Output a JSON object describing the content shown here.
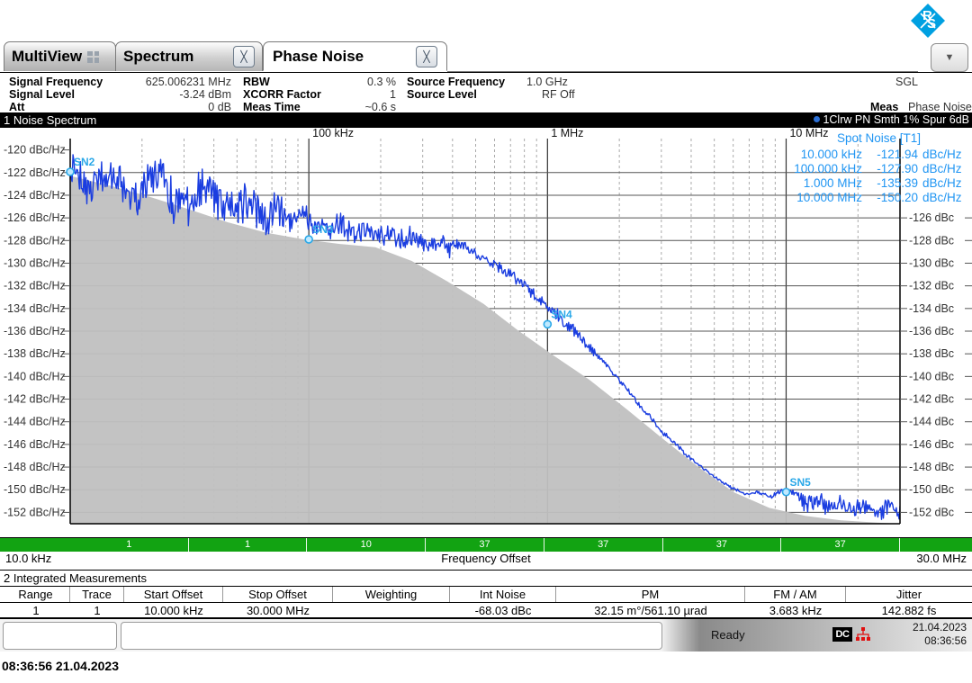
{
  "window": {
    "brand": "R&S",
    "dropdown_icon": "chevron-down-icon"
  },
  "tabs": [
    {
      "id": "multiview",
      "label": "MultiView",
      "icon": "grid-icon",
      "closable": false,
      "active": false
    },
    {
      "id": "spectrum",
      "label": "Spectrum",
      "icon": "close-icon",
      "closable": true,
      "active": false
    },
    {
      "id": "phase-noise",
      "label": "Phase Noise",
      "icon": "close-icon",
      "closable": true,
      "active": true
    }
  ],
  "info_header": {
    "col1": [
      {
        "key": "Signal Frequency",
        "value": "625.006231 MHz"
      },
      {
        "key": "Signal Level",
        "value": "-3.24 dBm"
      },
      {
        "key": "Att",
        "value": "0 dB"
      }
    ],
    "col2": [
      {
        "key": "RBW",
        "value": "0.3 %"
      },
      {
        "key": "XCORR Factor",
        "value": "1"
      },
      {
        "key": "Meas Time",
        "value": "~0.6 s"
      }
    ],
    "col3": [
      {
        "key": "Source Frequency",
        "value": "1.0 GHz"
      },
      {
        "key": "Source Level",
        "value": "RF Off"
      }
    ],
    "sgl": "SGL",
    "meas_key": "Meas",
    "meas_value": "Phase Noise"
  },
  "plot": {
    "title": "1 Noise Spectrum",
    "trace_header": "1Clrw PN Smth 1% Spur 6dB",
    "spot_noise_title": "Spot Noise [T1]",
    "spot_noise": [
      {
        "offset": "10.000 kHz",
        "value": "-121.94",
        "unit": "dBc/Hz"
      },
      {
        "offset": "100.000 kHz",
        "value": "-127.90",
        "unit": "dBc/Hz"
      },
      {
        "offset": "1.000 MHz",
        "value": "-135.39",
        "unit": "dBc/Hz"
      },
      {
        "offset": "10.000 MHz",
        "value": "-150.20",
        "unit": "dBc/Hz"
      }
    ],
    "markers": [
      {
        "name": "SN2",
        "x_hz": 10000,
        "y": -121.94
      },
      {
        "name": "SN3",
        "x_hz": 100000,
        "y": -127.9
      },
      {
        "name": "SN4",
        "x_hz": 1000000,
        "y": -135.39
      },
      {
        "name": "SN5",
        "x_hz": 10000000,
        "y": -150.2
      }
    ],
    "x_tick_labels": [
      {
        "label": "100 kHz",
        "hz": 100000
      },
      {
        "label": "1 MHz",
        "hz": 1000000
      },
      {
        "label": "10 MHz",
        "hz": 10000000
      }
    ],
    "x_start_label": "10.0 kHz",
    "x_stop_label": "30.0 MHz",
    "x_axis_title": "Frequency Offset",
    "y_left_unit": "dBc/Hz",
    "y_right_unit": "dBc",
    "y_ticks": [
      -120,
      -122,
      -124,
      -126,
      -128,
      -130,
      -132,
      -134,
      -136,
      -138,
      -140,
      -142,
      -144,
      -146,
      -148,
      -150,
      -152
    ],
    "segment_bar": [
      "1",
      "1",
      "10",
      "37",
      "37",
      "37",
      "37"
    ],
    "colors": {
      "trace": "#1a3de0",
      "marker": "#2aa8e8",
      "spot_text": "#2196f3",
      "fill": "#c0c0c0",
      "green_bar": "#12a312",
      "brand": "#00a0e1"
    }
  },
  "chart_data": {
    "type": "line",
    "title": "1 Noise Spectrum",
    "xlabel": "Frequency Offset",
    "ylabel": "dBc/Hz",
    "xscale": "log",
    "xlim": [
      10000,
      30000000
    ],
    "ylim": [
      -153,
      -119
    ],
    "grid": true,
    "legend_position": "top-right",
    "series": [
      {
        "name": "1Clrw PN Smth 1% Spur 6dB",
        "color": "#1a3de0",
        "x": [
          10000,
          11000,
          12000,
          13500,
          15000,
          17000,
          19000,
          21000,
          24000,
          27000,
          30000,
          34000,
          38000,
          43000,
          48000,
          54000,
          60000,
          68000,
          76000,
          85000,
          95000,
          107000,
          120000,
          135000,
          150000,
          170000,
          190000,
          215000,
          240000,
          270000,
          300000,
          340000,
          380000,
          430000,
          480000,
          540000,
          600000,
          680000,
          760000,
          850000,
          950000,
          1070000,
          1200000,
          1350000,
          1500000,
          1700000,
          1900000,
          2150000,
          2400000,
          2700000,
          3000000,
          3400000,
          3800000,
          4300000,
          4800000,
          5400000,
          6000000,
          6800000,
          7600000,
          8500000,
          9500000,
          10700000,
          12000000,
          13500000,
          15000000,
          17000000,
          19000000,
          21500000,
          24000000,
          27000000,
          30000000
        ],
        "y": [
          -121.94,
          -122.8,
          -123.9,
          -122.6,
          -121.5,
          -123.4,
          -124.5,
          -123.1,
          -122.3,
          -124.6,
          -125.3,
          -124.1,
          -123.0,
          -124.8,
          -125.6,
          -124.4,
          -125.0,
          -126.1,
          -125.3,
          -126.4,
          -125.6,
          -126.8,
          -127.2,
          -126.5,
          -127.5,
          -127.0,
          -127.9,
          -127.4,
          -128.0,
          -127.6,
          -128.3,
          -127.8,
          -128.6,
          -128.2,
          -128.9,
          -129.4,
          -130.1,
          -130.8,
          -131.6,
          -132.5,
          -133.4,
          -134.3,
          -135.39,
          -136.3,
          -137.4,
          -138.6,
          -139.8,
          -141.1,
          -142.4,
          -143.6,
          -144.9,
          -145.8,
          -146.9,
          -147.8,
          -148.6,
          -149.3,
          -149.9,
          -150.4,
          -150.2,
          -150.8,
          -150.1,
          -150.2,
          -151.3,
          -150.8,
          -151.6,
          -151.1,
          -151.8,
          -151.4,
          -152.0,
          -151.6,
          -151.9
        ]
      },
      {
        "name": "analyzer-noise-floor-fill",
        "color": "#c0c0c0",
        "fill": true,
        "x": [
          10000,
          15000,
          22000,
          32000,
          46000,
          66000,
          95000,
          135000,
          190000,
          270000,
          380000,
          540000,
          760000,
          1070000,
          1500000,
          2150000,
          3000000,
          4300000,
          6000000,
          8500000,
          12000000,
          17000000,
          24000000,
          30000000
        ],
        "y": [
          -122.3,
          -123.2,
          -124.2,
          -125.3,
          -126.4,
          -127.3,
          -127.9,
          -128.3,
          -128.6,
          -129.8,
          -131.6,
          -133.6,
          -136.0,
          -138.2,
          -140.3,
          -142.9,
          -145.4,
          -148.0,
          -150.2,
          -151.6,
          -152.3,
          -152.7,
          -152.9,
          -153.0
        ]
      }
    ]
  },
  "measurements": {
    "title": "2 Integrated Measurements",
    "columns": [
      "Range",
      "Trace",
      "Start Offset",
      "Stop Offset",
      "Weighting",
      "Int Noise",
      "PM",
      "FM / AM",
      "Jitter"
    ],
    "rows": [
      [
        "1",
        "1",
        "10.000 kHz",
        "30.000 MHz",
        "",
        "-68.03 dBc",
        "32.15 m°/561.10 µrad",
        "3.683 kHz",
        "142.882 fs"
      ]
    ]
  },
  "status_bar": {
    "state": "Ready",
    "dc_label": "DC",
    "network_icon": "network-icon",
    "date": "21.04.2023",
    "time": "08:36:56"
  },
  "footer": {
    "timestamp": "08:36:56  21.04.2023"
  }
}
